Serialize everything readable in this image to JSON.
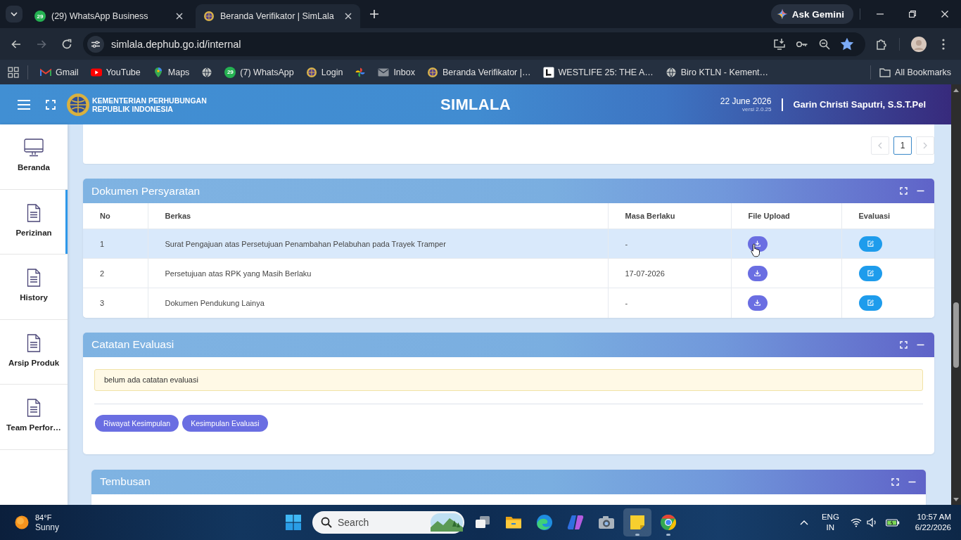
{
  "browser": {
    "tabs": [
      {
        "kind": "whatsapp",
        "badge": "29",
        "title": "(29) WhatsApp Business",
        "selected": false
      },
      {
        "kind": "emblem",
        "title": "Beranda Verifikator | SimLala",
        "selected": true
      }
    ],
    "gemini_button": "Ask Gemini",
    "back_disabled": false,
    "forward_disabled": true,
    "address": "simlala.dephub.go.id/internal",
    "bookmarked": true,
    "bookmarks": [
      {
        "kind": "gmail",
        "label": "Gmail"
      },
      {
        "kind": "youtube",
        "label": "YouTube"
      },
      {
        "kind": "maps",
        "label": "Maps"
      },
      {
        "kind": "globe"
      },
      {
        "kind": "whatsapp",
        "badge": "29",
        "label": "(7) WhatsApp"
      },
      {
        "kind": "emblem",
        "label": "Login"
      },
      {
        "kind": "pinwheel"
      },
      {
        "kind": "mail",
        "label": "Inbox"
      },
      {
        "kind": "emblem",
        "label": "Beranda Verifikator |…"
      },
      {
        "kind": "square",
        "label": "WESTLIFE 25: THE A…"
      },
      {
        "kind": "globe",
        "label": "Biro KTLN - Kement…"
      }
    ],
    "all_bookmarks": "All Bookmarks"
  },
  "header": {
    "org_lines": [
      "KEMENTERIAN PERHUBUNGAN",
      "REPUBLIK INDONESIA"
    ],
    "app_title": "SIMLALA",
    "date": "22 June 2026",
    "version": "versi 2.0.25",
    "user": "Garin Christi Saputri, S.S.T.Pel"
  },
  "sidebar": {
    "items": [
      {
        "kind": "monitor",
        "label": "Beranda",
        "selected": false
      },
      {
        "kind": "document",
        "label": "Perizinan",
        "selected": true
      },
      {
        "kind": "document",
        "label": "History",
        "selected": false
      },
      {
        "kind": "document",
        "label": "Arsip Produk",
        "selected": false
      },
      {
        "kind": "document",
        "label": "Team Perfor…",
        "selected": false
      }
    ]
  },
  "pagination": {
    "previous": {
      "disabled": true
    },
    "pages": [
      {
        "label": "1",
        "selected": true
      }
    ],
    "next": {
      "disabled": true
    }
  },
  "documents": {
    "title": "Dokumen Persyaratan",
    "columns": [
      "No",
      "Berkas",
      "Masa Berlaku",
      "File Upload",
      "Evaluasi"
    ],
    "rows": [
      {
        "no": "1",
        "file": "Surat Pengajuan atas Persetujuan Penambahan Pelabuhan pada Trayek Tramper",
        "valid_until": "-",
        "highlighted": true
      },
      {
        "no": "2",
        "file": "Persetujuan atas RPK yang Masih Berlaku",
        "valid_until": "17-07-2026",
        "highlighted": false
      },
      {
        "no": "3",
        "file": "Dokumen Pendukung Lainya",
        "valid_until": "-",
        "highlighted": false
      }
    ]
  },
  "evaluation_notes": {
    "title": "Catatan Evaluasi",
    "message": "belum ada catatan evaluasi",
    "buttons": [
      "Riwayat Kesimpulan",
      "Kesimpulan Evaluasi"
    ]
  },
  "copies": {
    "title": "Tembusan"
  },
  "taskbar": {
    "weather": {
      "temperature": "84°F",
      "condition": "Sunny"
    },
    "search": {
      "placeholder": "Search"
    },
    "apps": [
      {
        "kind": "task-view",
        "running": false,
        "highlighted": false
      },
      {
        "kind": "folder",
        "running": false,
        "highlighted": false
      },
      {
        "kind": "edge",
        "running": false,
        "highlighted": false
      },
      {
        "kind": "copilot",
        "running": false,
        "highlighted": false
      },
      {
        "kind": "camera",
        "running": false,
        "highlighted": false
      },
      {
        "kind": "notes",
        "running": true,
        "highlighted": true
      },
      {
        "kind": "chrome",
        "running": true,
        "highlighted": false
      }
    ],
    "language": "ENG",
    "region": "IN",
    "time": "10:57 AM",
    "date": "6/22/2026"
  }
}
